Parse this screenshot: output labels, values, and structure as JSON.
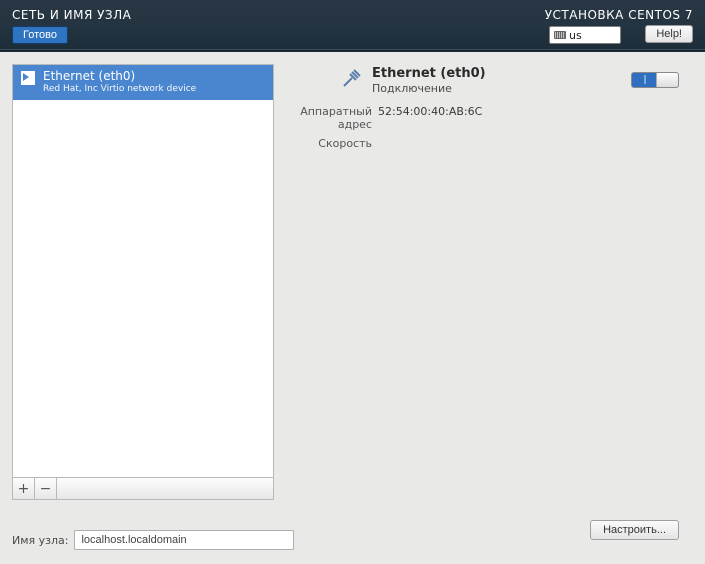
{
  "header": {
    "title": "СЕТЬ И ИМЯ УЗЛА",
    "install_label": "УСТАНОВКА CENTOS 7",
    "done_button": "Готово",
    "keyboard_layout": "us",
    "help_button": "Help!"
  },
  "sidebar": {
    "items": [
      {
        "name": "Ethernet (eth0)",
        "vendor": "Red Hat, Inc Virtio network device"
      }
    ],
    "add_label": "+",
    "remove_label": "−"
  },
  "details": {
    "title": "Ethernet (eth0)",
    "status": "Подключение",
    "switch_label": "|",
    "hw_address_label": "Аппаратный адрес",
    "hw_address_value": "52:54:00:40:AB:6C",
    "speed_label": "Скорость",
    "speed_value": "",
    "configure_button": "Настроить..."
  },
  "hostname": {
    "label": "Имя узла:",
    "value": "localhost.localdomain"
  }
}
